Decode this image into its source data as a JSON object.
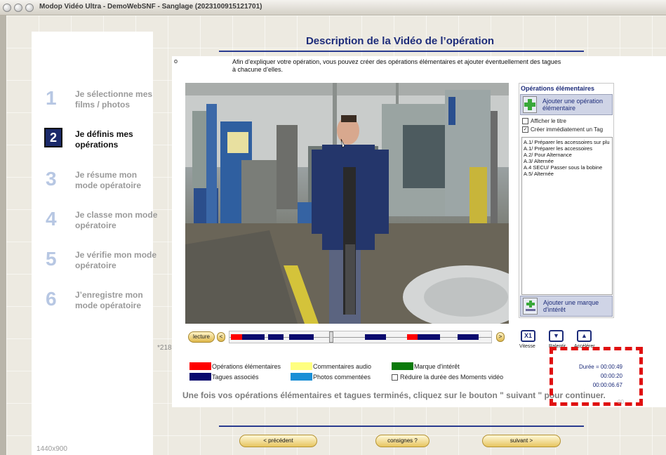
{
  "window": {
    "title": "Modop Vidéo Ultra - DemoWebSNF - Sanglage (2023100915121701)"
  },
  "page": {
    "title": "Description de la Vidéo de l’opération"
  },
  "steps": [
    {
      "number": "1",
      "label": "Je sélectionne mes films / photos",
      "active": false
    },
    {
      "number": "2",
      "label": "Je définis mes opérations",
      "active": true
    },
    {
      "number": "3",
      "label": "Je résume mon mode opératoire",
      "active": false
    },
    {
      "number": "4",
      "label": "Je classe mon mode opératoire",
      "active": false
    },
    {
      "number": "5",
      "label": "Je vérifie mon mode opératoire",
      "active": false
    },
    {
      "number": "6",
      "label": "J’enregistre mon mode opératoire",
      "active": false
    }
  ],
  "screen_resolution": "1440x900",
  "intro": {
    "bullet": "o",
    "text": "Afin d’expliquer votre opération, vous pouvez créer des opérations élémentaires et ajouter éventuellement des tagues à chacune d’elles."
  },
  "operations": {
    "title": "Opérations élémentaires",
    "add_button": "Ajouter une opération élémentaire",
    "show_title": {
      "label": "Afficher le titre",
      "checked": false
    },
    "create_tag": {
      "label": "Créer immédiatement un Tag",
      "checked": true
    },
    "check_mark": "✓",
    "items": [
      "A.1/ Préparer les accessoires sur plu",
      "A.1/ Préparer les accessoires",
      "A.2/ Pour Alternance",
      "A.3/ Alternée",
      "A.4 SECU/ Passer sous la bobine",
      "A.5/ Alternée"
    ],
    "add_mark_button": "Ajouter une marque d'intérêt"
  },
  "timeline": {
    "play_button": "lecture",
    "prev_arrow": "<",
    "next_arrow": ">",
    "side_value": "*218",
    "thumb_fraction": 0.38
  },
  "controls": {
    "speed": {
      "symbol": "X1",
      "label": "Vitesse"
    },
    "slow": {
      "symbol": "▼",
      "label": "Ralentir"
    },
    "fast": {
      "symbol": "▲",
      "label": "Accélérer"
    }
  },
  "legend": [
    {
      "label": "Opérations élémentaires",
      "color": "#ff0000"
    },
    {
      "label": "Tagues associés",
      "color": "#0a0a6e"
    },
    {
      "label": "Commentaires audio",
      "color": "#ffff80"
    },
    {
      "label": "Photos commentées",
      "color": "#1a8fd6"
    },
    {
      "label": "Marque d'intérêt",
      "color": "#0a7a0a"
    }
  ],
  "reduce_duration": {
    "label": "Réduire la durée des Moments vidéo",
    "checked": false
  },
  "durations": {
    "total": "Durée = 00:00:49",
    "current": "00:00:20",
    "precise": "00:00:06.67"
  },
  "annotation_tag": "00",
  "instruction": "Une fois vos opérations élémentaires et tagues terminés, cliquez sur le bouton \" suivant \" pour continuer.",
  "nav": {
    "previous": "< précédent",
    "instructions": "consignes ?",
    "next": "suivant >"
  },
  "colors": {
    "accent": "#1d2c7a",
    "annotation": "#e01010",
    "button_gold": "#e0b94c"
  }
}
